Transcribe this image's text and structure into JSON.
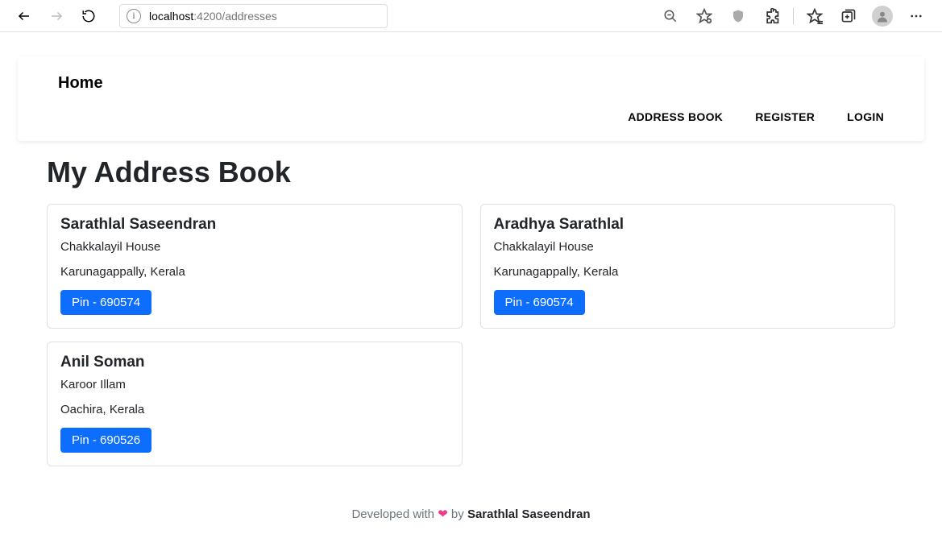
{
  "browser": {
    "url_host": "localhost",
    "url_port_path": ":4200/addresses"
  },
  "header": {
    "brand": "Home",
    "nav": {
      "address_book": "ADDRESS BOOK",
      "register": "REGISTER",
      "login": "LOGIN"
    }
  },
  "main": {
    "title": "My Address Book",
    "cards": [
      {
        "name": "Sarathlal Saseendran",
        "house": "Chakkalayil House",
        "locality": "Karunagappally, Kerala",
        "pin_label": "Pin - 690574"
      },
      {
        "name": "Aradhya Sarathlal",
        "house": "Chakkalayil House",
        "locality": "Karunagappally, Kerala",
        "pin_label": "Pin - 690574"
      },
      {
        "name": "Anil Soman",
        "house": "Karoor Illam",
        "locality": "Oachira, Kerala",
        "pin_label": "Pin - 690526"
      }
    ]
  },
  "footer": {
    "prefix": "Developed with ",
    "heart": "❤",
    "mid": " by ",
    "author": "Sarathlal Saseendran"
  }
}
